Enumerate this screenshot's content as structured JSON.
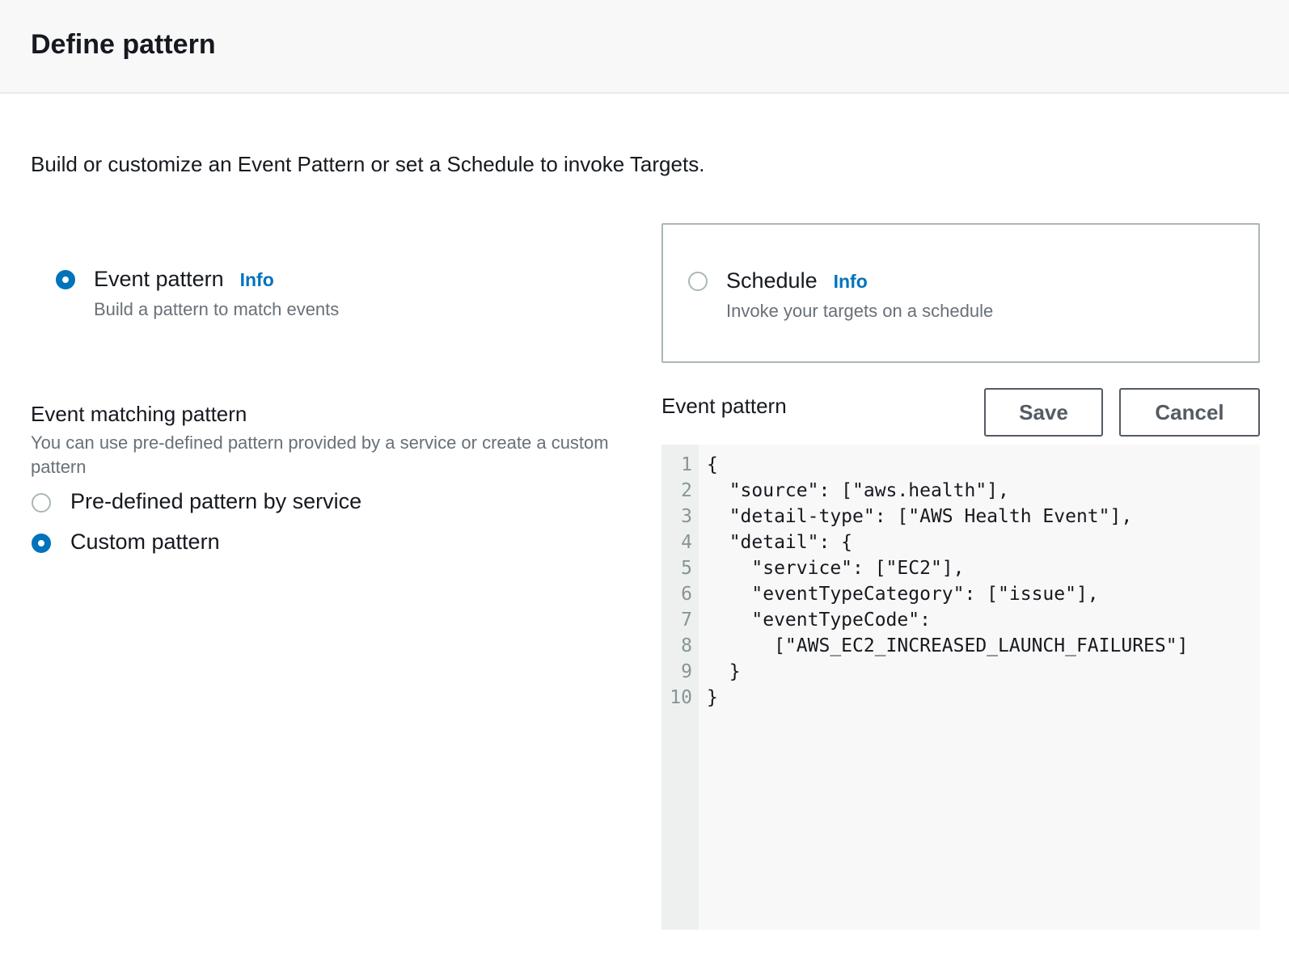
{
  "header": {
    "title": "Define pattern"
  },
  "description": "Build or customize an Event Pattern or set a Schedule to invoke Targets.",
  "pattern_type": {
    "event_pattern": {
      "label": "Event pattern",
      "info": "Info",
      "description": "Build a pattern to match events",
      "selected": true
    },
    "schedule": {
      "label": "Schedule",
      "info": "Info",
      "description": "Invoke your targets on a schedule",
      "selected": false
    }
  },
  "matching": {
    "title": "Event matching pattern",
    "description": "You can use pre-defined pattern provided by a service or create a custom pattern",
    "options": [
      {
        "label": "Pre-defined pattern by service",
        "selected": false
      },
      {
        "label": "Custom pattern",
        "selected": true
      }
    ]
  },
  "editor": {
    "title": "Event pattern",
    "save_label": "Save",
    "cancel_label": "Cancel",
    "line_numbers": [
      "1",
      "2",
      "3",
      "4",
      "5",
      "6",
      "7",
      "8",
      "9",
      "10"
    ],
    "lines": [
      "{",
      "  \"source\": [\"aws.health\"],",
      "  \"detail-type\": [\"AWS Health Event\"],",
      "  \"detail\": {",
      "    \"service\": [\"EC2\"],",
      "    \"eventTypeCategory\": [\"issue\"],",
      "    \"eventTypeCode\":",
      "      [\"AWS_EC2_INCREASED_LAUNCH_FAILURES\"]",
      "  }",
      "}"
    ]
  }
}
